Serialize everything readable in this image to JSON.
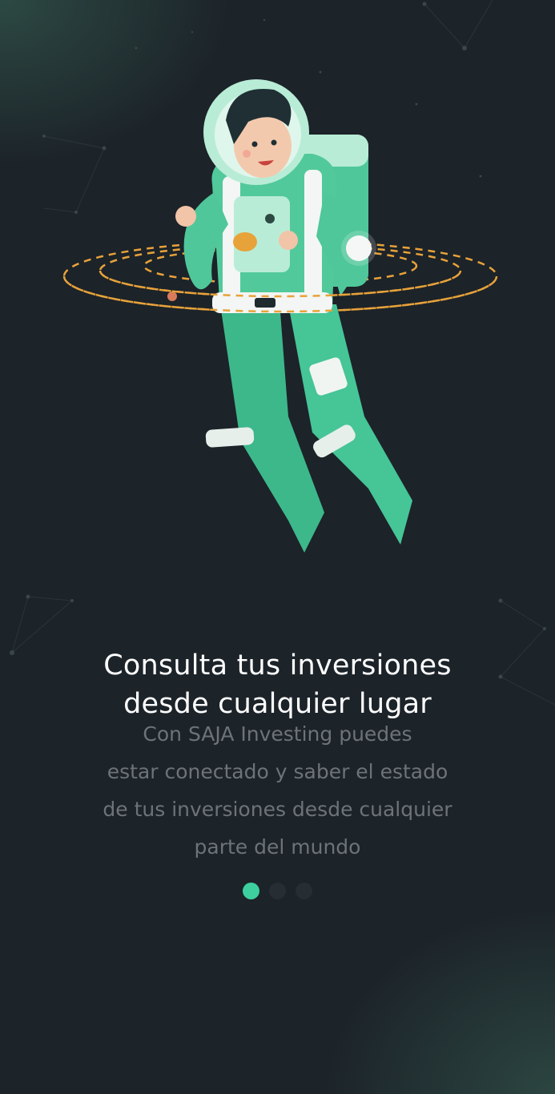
{
  "onboarding": {
    "title_lines": [
      "Consulta tus inversiones",
      "desde cualquier lugar"
    ],
    "description_lines": [
      "Con SAJA Investing puedes",
      "estar conectado y saber el estado",
      "de tus inversiones desde cualquier",
      "parte del mundo"
    ],
    "page_indicator": {
      "total": 3,
      "active_index": 0
    },
    "illustration": "astronaut-floating-with-orbits"
  },
  "colors": {
    "background": "#1c2329",
    "accent": "#3ecf9e",
    "title_text": "#ffffff",
    "body_text": "#6d7378",
    "inactive_dot": "#262d33",
    "orbit": "#e8a23a"
  }
}
